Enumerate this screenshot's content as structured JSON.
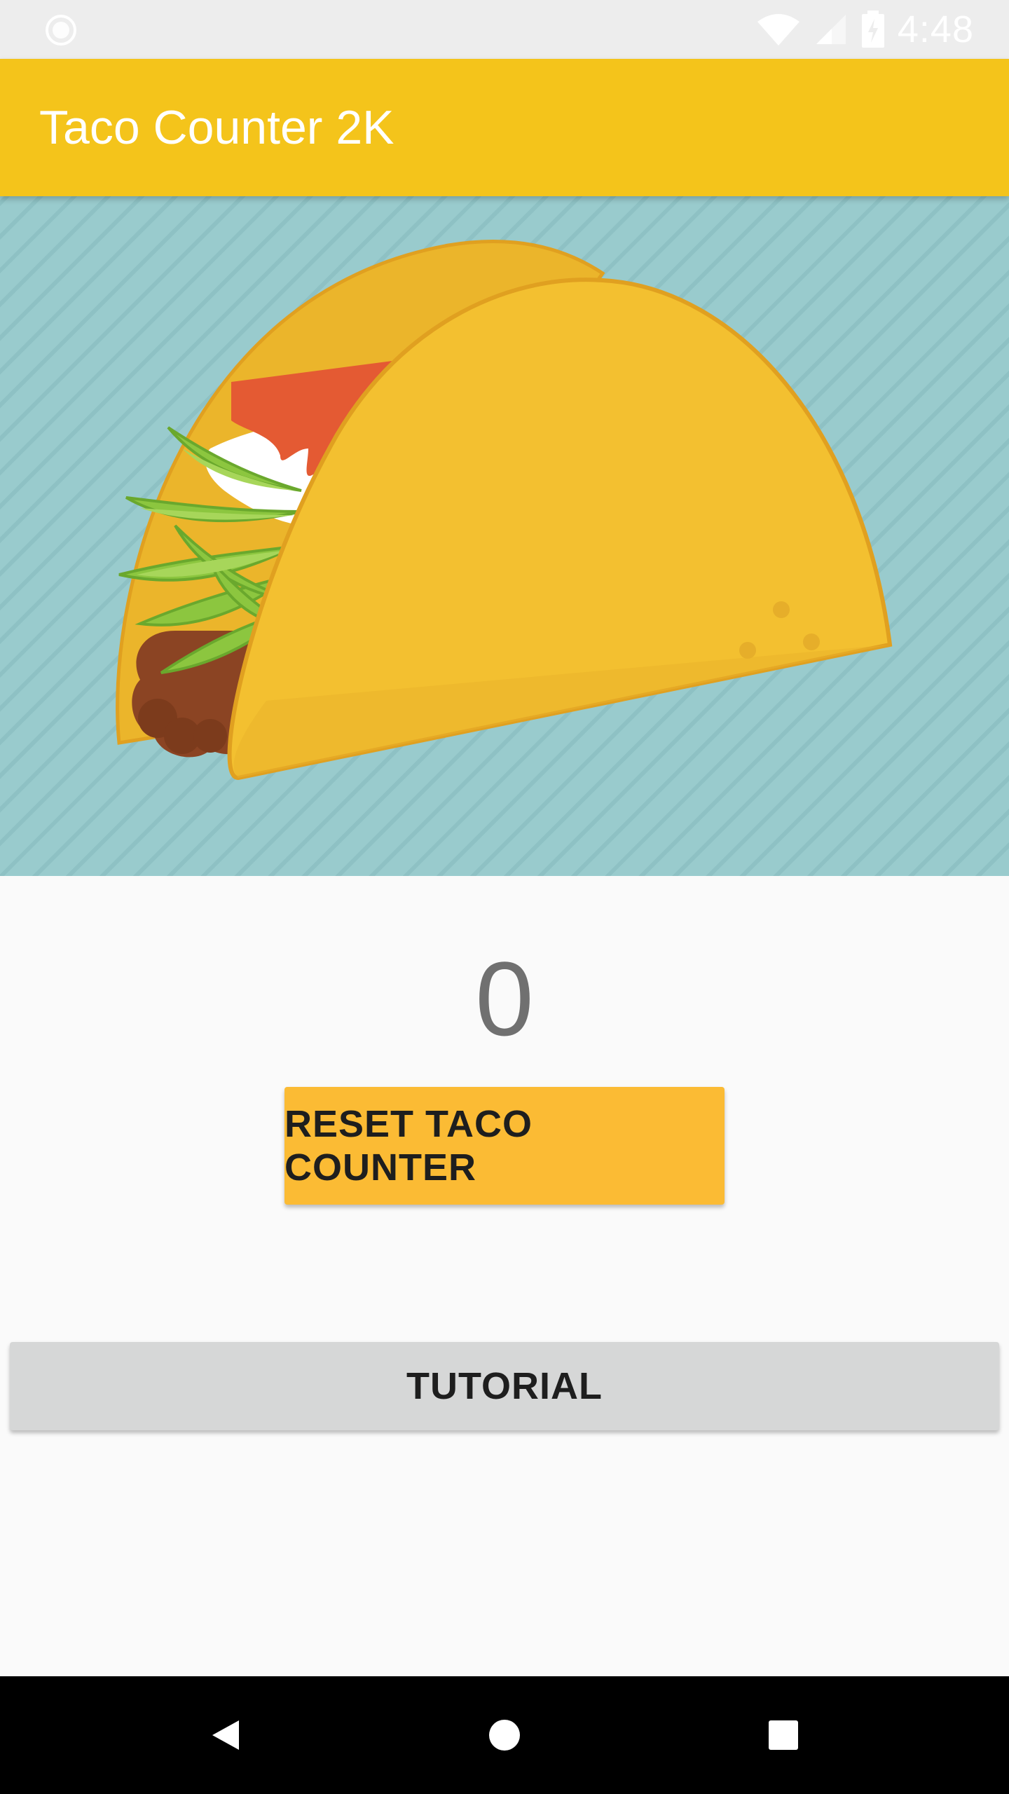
{
  "status_bar": {
    "time": "4:48",
    "icons": [
      "notification-icon",
      "wifi-icon",
      "signal-icon",
      "battery-charging-icon"
    ]
  },
  "app_bar": {
    "title": "Taco Counter 2K",
    "color": "#f4c41b"
  },
  "hero": {
    "image": "taco-illustration",
    "background_color": "#99cbcd"
  },
  "counter": {
    "value": "0"
  },
  "buttons": {
    "reset_label": "RESET TACO COUNTER",
    "tutorial_label": "TUTORIAL",
    "reset_color": "#fbbb34",
    "tutorial_color": "#d6d7d7"
  },
  "nav_bar": {
    "items": [
      "back-icon",
      "home-icon",
      "recents-icon"
    ]
  }
}
